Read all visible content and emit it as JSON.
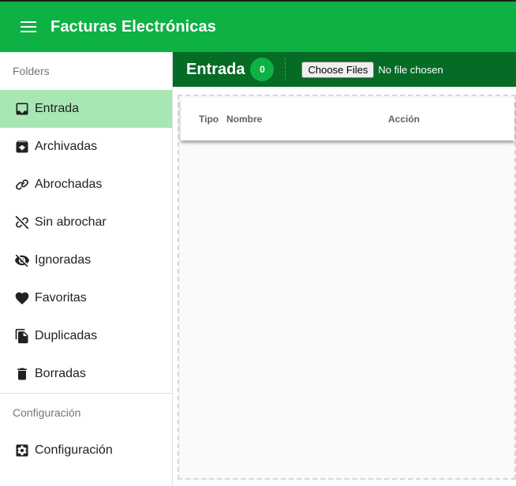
{
  "app": {
    "title": "Facturas Electrónicas",
    "accent": "#0db144",
    "accent_dark": "#056b25",
    "active_bg": "#a8e6b3"
  },
  "sidebar": {
    "folders_header": "Folders",
    "items": [
      {
        "label": "Entrada",
        "icon": "inbox-icon",
        "active": true
      },
      {
        "label": "Archivadas",
        "icon": "archive-icon"
      },
      {
        "label": "Abrochadas",
        "icon": "link-icon"
      },
      {
        "label": "Sin abrochar",
        "icon": "link-off-icon"
      },
      {
        "label": "Ignoradas",
        "icon": "eye-off-icon"
      },
      {
        "label": "Favoritas",
        "icon": "heart-icon"
      },
      {
        "label": "Duplicadas",
        "icon": "duplicate-icon"
      },
      {
        "label": "Borradas",
        "icon": "trash-icon"
      }
    ],
    "config_header": "Configuración",
    "config_item": {
      "label": "Configuración",
      "icon": "settings-icon"
    }
  },
  "main": {
    "title": "Entrada",
    "count": "0",
    "file_button": "Choose Files",
    "file_status": "No file chosen",
    "columns": [
      "Tipo",
      "Nombre",
      "Acción"
    ]
  }
}
